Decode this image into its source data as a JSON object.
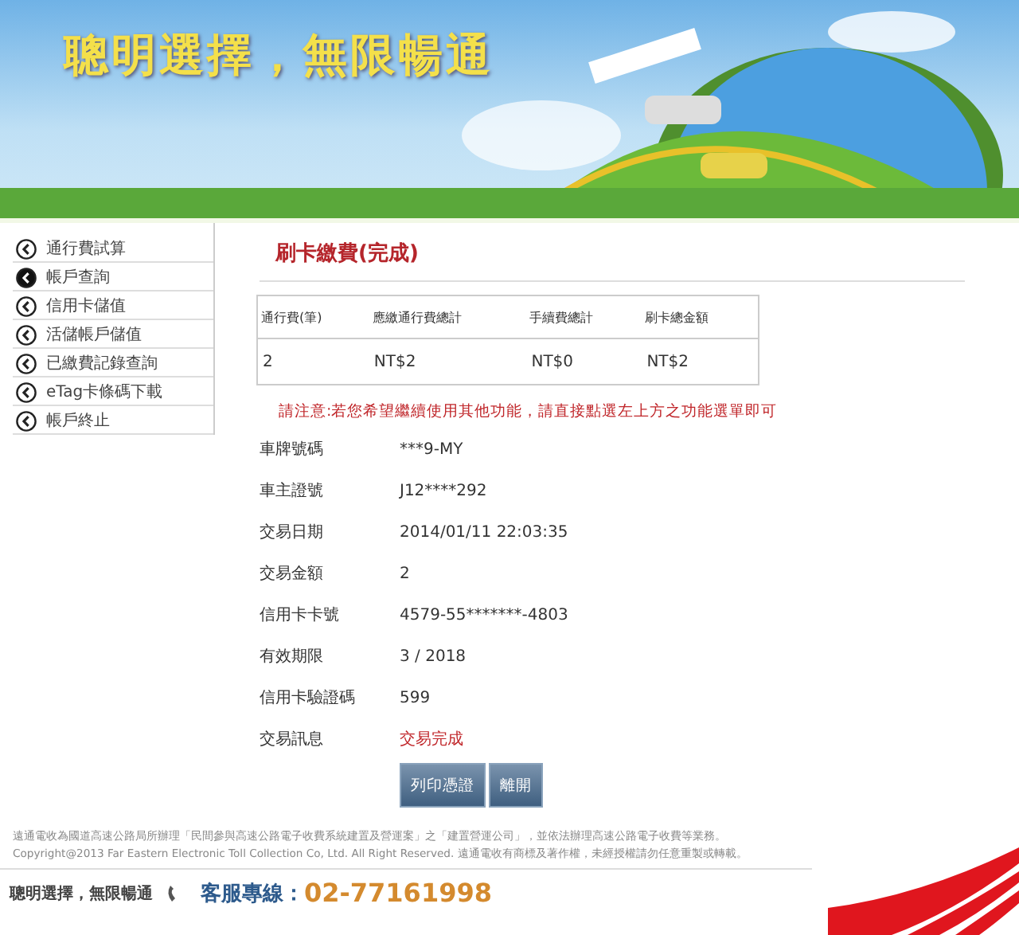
{
  "banner": {
    "title": "聰明選擇，無限暢通"
  },
  "sidebar": {
    "items": [
      {
        "label": "通行費試算",
        "selected": false
      },
      {
        "label": "帳戶查詢",
        "selected": true
      },
      {
        "label": "信用卡儲值",
        "selected": false
      },
      {
        "label": "活儲帳戶儲值",
        "selected": false
      },
      {
        "label": "已繳費記錄查詢",
        "selected": false
      },
      {
        "label": "eTag卡條碼下載",
        "selected": false
      },
      {
        "label": "帳戶終止",
        "selected": false
      }
    ]
  },
  "page_title": "刷卡繳費(完成)",
  "table": {
    "columns": [
      "通行費(筆)",
      "應繳通行費總計",
      "手續費總計",
      "刷卡總金額"
    ],
    "rows": [
      [
        "2",
        "NT$2",
        "NT$0",
        "NT$2"
      ]
    ]
  },
  "notice": "請注意:若您希望繼續使用其他功能，請直接點選左上方之功能選單即可",
  "details": [
    {
      "label": "車牌號碼",
      "value": "***9-MY",
      "kind": "plain"
    },
    {
      "label": "車主證號",
      "value": "J12****292",
      "kind": "plain"
    },
    {
      "label": "交易日期",
      "value": "2014/01/11 22:03:35",
      "kind": "plain"
    },
    {
      "label": "交易金額",
      "value": "2",
      "kind": "plain"
    },
    {
      "label": "信用卡卡號",
      "value": "4579-55*******-4803",
      "kind": "plain"
    },
    {
      "label": "有效期限",
      "value": "3 / 2018",
      "kind": "plain"
    },
    {
      "label": "信用卡驗證碼",
      "value": "599",
      "kind": "plain"
    },
    {
      "label": "交易訊息",
      "value": "交易完成",
      "kind": "status"
    }
  ],
  "buttons": [
    "列印憑證",
    "離開"
  ],
  "footer": {
    "lines": [
      "遠通電收為國道高速公路局所辦理「民間參與高速公路電子收費系統建置及營運案」之「建置營運公司」，並依法辦理高速公路電子收費等業務。",
      "Copyright@2013 Far Eastern Electronic Toll Collection Co, Ltd. All Right Reserved. 遠通電收有商標及著作權，未經授權請勿任意重製或轉載。"
    ],
    "slogan": "聰明選擇，無限暢通",
    "hotline_label": "客服專線：",
    "hotline_number": "02-77161998"
  }
}
